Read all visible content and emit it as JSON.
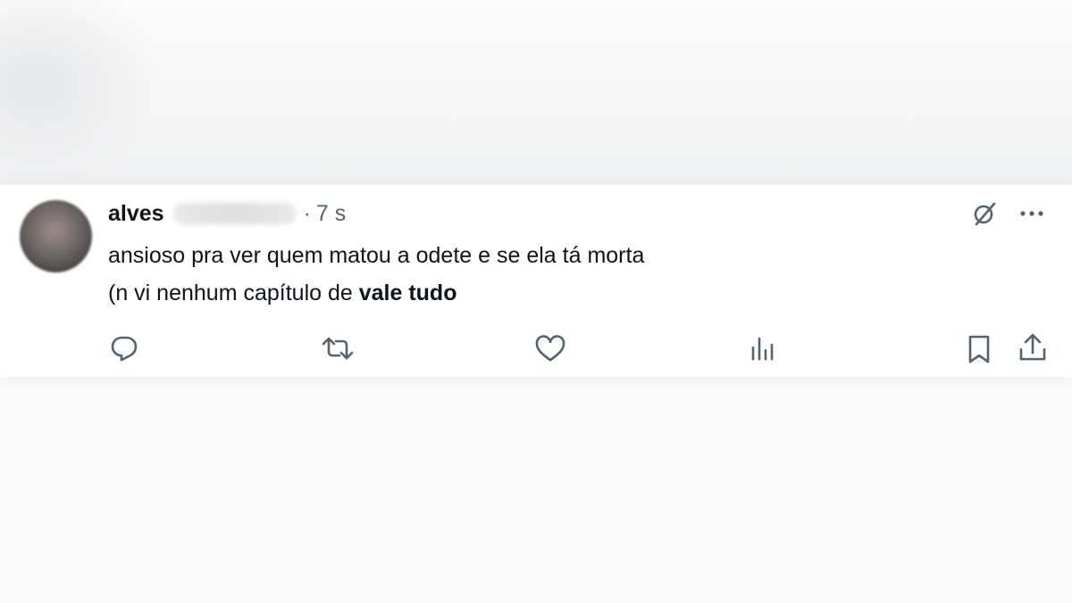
{
  "tweet": {
    "author_name": "alves",
    "separator": "·",
    "time": "7 s",
    "text_line1": "ansioso pra ver quem matou a odete e se ela tá morta",
    "text_line2_prefix": "(n vi nenhum capítulo de ",
    "text_line2_bold": "vale tudo"
  },
  "icons": {
    "grok": "grok-icon",
    "more": "more-icon",
    "reply": "reply-icon",
    "retweet": "retweet-icon",
    "like": "like-icon",
    "views": "views-icon",
    "bookmark": "bookmark-icon",
    "share": "share-icon"
  },
  "colors": {
    "text": "#0f1419",
    "secondary": "#536471"
  }
}
